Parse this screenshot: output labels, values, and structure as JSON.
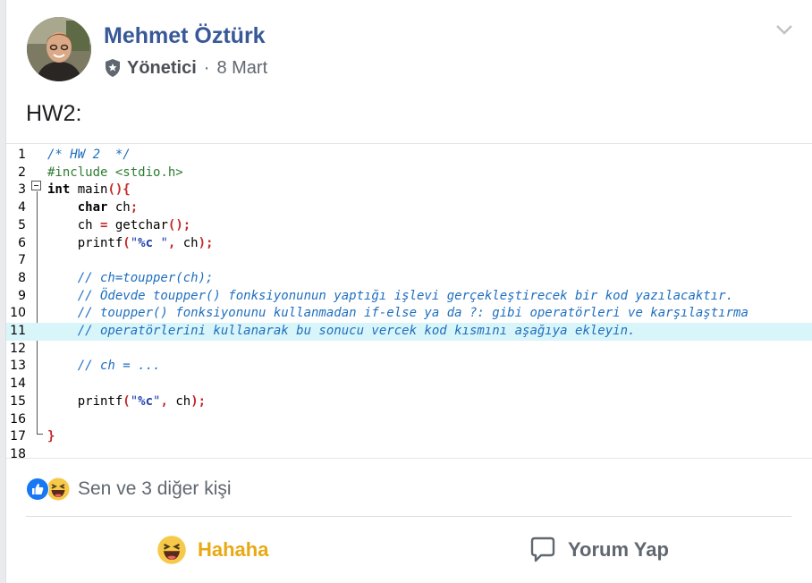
{
  "post": {
    "author": "Mehmet Öztürk",
    "role": "Yönetici",
    "separator": "·",
    "date": "8 Mart",
    "text": "HW2:"
  },
  "code": {
    "highlight_line": 11,
    "lines": [
      {
        "n": "1",
        "tokens": [
          {
            "t": "/* HW 2  */",
            "c": "com"
          }
        ]
      },
      {
        "n": "2",
        "tokens": [
          {
            "t": "#include <stdio.h>",
            "c": "pre"
          }
        ]
      },
      {
        "n": "3",
        "tokens": [
          {
            "t": "int",
            "c": "kw"
          },
          {
            "t": " main",
            "c": "id"
          },
          {
            "t": "(){",
            "c": "op"
          }
        ]
      },
      {
        "n": "4",
        "tokens": [
          {
            "t": "    ",
            "c": "id"
          },
          {
            "t": "char",
            "c": "kw"
          },
          {
            "t": " ch",
            "c": "id"
          },
          {
            "t": ";",
            "c": "op"
          }
        ]
      },
      {
        "n": "5",
        "tokens": [
          {
            "t": "    ch ",
            "c": "id"
          },
          {
            "t": "=",
            "c": "op"
          },
          {
            "t": " getchar",
            "c": "id"
          },
          {
            "t": "();",
            "c": "op"
          }
        ]
      },
      {
        "n": "6",
        "tokens": [
          {
            "t": "    printf",
            "c": "id"
          },
          {
            "t": "(",
            "c": "op"
          },
          {
            "t": "\"",
            "c": "str"
          },
          {
            "t": "%c",
            "c": "fmt"
          },
          {
            "t": " \"",
            "c": "str"
          },
          {
            "t": ",",
            "c": "op"
          },
          {
            "t": " ch",
            "c": "id"
          },
          {
            "t": ");",
            "c": "op"
          }
        ]
      },
      {
        "n": "7",
        "tokens": []
      },
      {
        "n": "8",
        "tokens": [
          {
            "t": "    // ch=toupper(ch);",
            "c": "com"
          }
        ]
      },
      {
        "n": "9",
        "tokens": [
          {
            "t": "    // Ödevde toupper() fonksiyonunun yaptığı işlevi gerçekleştirecek bir kod yazılacaktır.",
            "c": "com"
          }
        ]
      },
      {
        "n": "10",
        "tokens": [
          {
            "t": "    // toupper() fonksiyonunu kullanmadan if-else ya da ?: gibi operatörleri ve karşılaştırma",
            "c": "com"
          }
        ]
      },
      {
        "n": "11",
        "tokens": [
          {
            "t": "    // operatörlerini kullanarak bu sonucu vercek kod kısmını aşağıya ekleyin.",
            "c": "com"
          }
        ]
      },
      {
        "n": "12",
        "tokens": []
      },
      {
        "n": "13",
        "tokens": [
          {
            "t": "    // ch = ...",
            "c": "com"
          }
        ]
      },
      {
        "n": "14",
        "tokens": []
      },
      {
        "n": "15",
        "tokens": [
          {
            "t": "    printf",
            "c": "id"
          },
          {
            "t": "(",
            "c": "op"
          },
          {
            "t": "\"",
            "c": "str"
          },
          {
            "t": "%c",
            "c": "fmt"
          },
          {
            "t": "\"",
            "c": "str"
          },
          {
            "t": ",",
            "c": "op"
          },
          {
            "t": " ch",
            "c": "id"
          },
          {
            "t": ");",
            "c": "op"
          }
        ]
      },
      {
        "n": "16",
        "tokens": []
      },
      {
        "n": "17",
        "tokens": [
          {
            "t": "}",
            "c": "op"
          }
        ]
      },
      {
        "n": "18",
        "tokens": []
      }
    ]
  },
  "reactions": {
    "icons": [
      "like-icon",
      "haha-icon"
    ],
    "summary": "Sen ve 3 diğer kişi"
  },
  "actions": {
    "haha_label": "Hahaha",
    "comment_label": "Yorum Yap"
  },
  "colors": {
    "author": "#385898",
    "haha": "#e8a912",
    "like": "#1877f2",
    "highlight": "#d8f5fa"
  }
}
